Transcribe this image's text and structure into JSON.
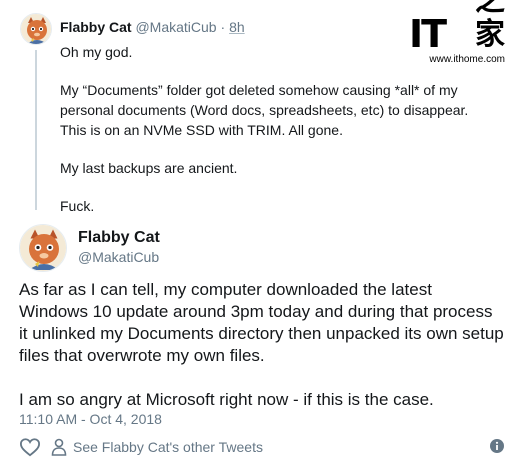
{
  "watermark": {
    "logo_it": "IT",
    "logo_zh": "之家",
    "url": "www.ithome.com"
  },
  "parent_tweet": {
    "name": "Flabby Cat",
    "handle": "@MakatiCub",
    "separator": "·",
    "time": "8h",
    "paragraphs": [
      "Oh my god.",
      "My “Documents” folder got deleted somehow causing *all* of my personal documents (Word docs, spreadsheets, etc) to disappear. This is on an NVMe SSD with TRIM. All gone.",
      "My last backups are ancient.",
      "Fuck."
    ]
  },
  "main_tweet": {
    "name": "Flabby Cat",
    "handle": "@MakatiCub",
    "paragraphs": [
      "As far as I can tell, my computer downloaded the latest Windows 10 update around 3pm today and during that process it unlinked my Documents directory then unpacked its own setup files that overwrote my own files.",
      "I am so angry at Microsoft right now - if this is the case."
    ],
    "timestamp": "11:10 AM - Oct 4, 2018"
  },
  "footer": {
    "see_others": "See Flabby Cat's other Tweets",
    "icons": [
      "heart-icon",
      "person-icon",
      "info-icon"
    ]
  },
  "colors": {
    "text": "#14171a",
    "secondary": "#657786",
    "thread_line": "#ccd6dd"
  }
}
